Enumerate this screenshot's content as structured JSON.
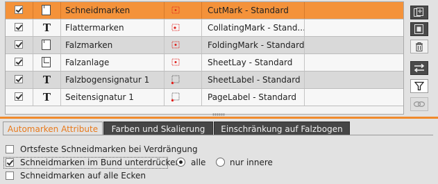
{
  "marks": [
    {
      "enabled": true,
      "type_icon": "document-icon",
      "name": "Schneidmarken",
      "mark_icon": "cut-mark-icon",
      "definition": "CutMark - Standard",
      "selected": true
    },
    {
      "enabled": true,
      "type_icon": "text-T-icon",
      "type_text": "T",
      "name": "Flattermarken",
      "mark_icon": "collating-mark-icon",
      "definition": "CollatingMark - Stand...",
      "selected": false
    },
    {
      "enabled": true,
      "type_icon": "document-icon",
      "name": "Falzmarken",
      "mark_icon": "folding-mark-icon",
      "definition": "FoldingMark - Standard",
      "selected": false
    },
    {
      "enabled": true,
      "type_icon": "sheet-lay-icon",
      "name": "Falzanlage",
      "mark_icon": "sheet-lay-mark-icon",
      "definition": "SheetLay - Standard",
      "selected": false
    },
    {
      "enabled": true,
      "type_icon": "text-T-icon",
      "type_text": "T",
      "name": "Falzbogensignatur 1",
      "mark_icon": "sheet-label-mark-icon",
      "definition": "SheetLabel - Standard",
      "selected": false
    },
    {
      "enabled": true,
      "type_icon": "text-T-icon",
      "type_text": "T",
      "name": "Seitensignatur 1",
      "mark_icon": "page-label-mark-icon",
      "definition": "PageLabel - Standard",
      "selected": false
    }
  ],
  "tabs": [
    {
      "label": "Automarken Attribute",
      "active": true
    },
    {
      "label": "Farben und Skalierung",
      "active": false
    },
    {
      "label": "Einschränkung auf Falzbogen",
      "active": false
    }
  ],
  "options": {
    "fixed_cut_marks": {
      "label": "Ortsfeste Schneidmarken bei Verdrängung",
      "checked": false
    },
    "suppress_in_spine": {
      "label": "Schneidmarken im Bund unterdrücken",
      "checked": true
    },
    "radio_all": {
      "label": "alle",
      "selected": true
    },
    "radio_inner": {
      "label": "nur innere",
      "selected": false
    },
    "all_corners": {
      "label": "Schneidmarken auf alle Ecken",
      "checked": false
    }
  },
  "toolbar_icons": [
    "add-mark-icon",
    "duplicate-icon",
    "trash-icon",
    "swap-icon",
    "filter-icon",
    "link-icon"
  ],
  "colors": {
    "accent": "#f08a2c",
    "selected_row": "#f4923a",
    "mark_red": "#e0201c"
  }
}
